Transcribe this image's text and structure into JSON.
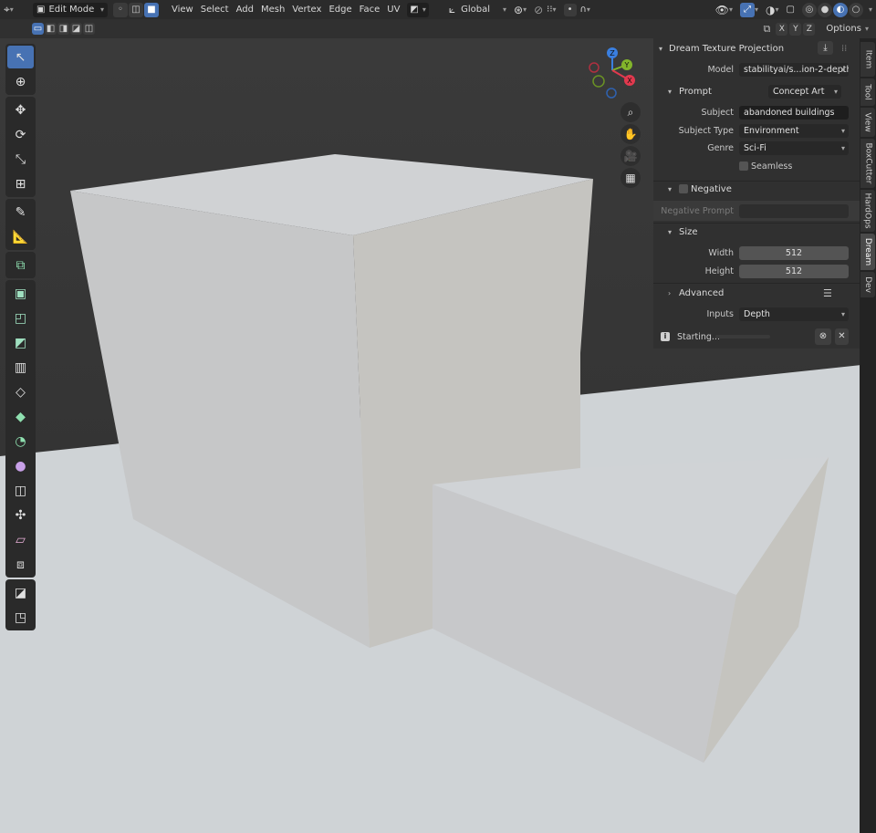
{
  "header": {
    "mode": "Edit Mode",
    "menus": [
      "View",
      "Select",
      "Add",
      "Mesh",
      "Vertex",
      "Edge",
      "Face",
      "UV"
    ],
    "transform_orientation": "Global"
  },
  "subheader": {
    "axes": [
      "X",
      "Y",
      "Z"
    ],
    "options_label": "Options"
  },
  "gizmo": {
    "x": "X",
    "y": "Y",
    "z": "Z"
  },
  "panel": {
    "title": "Dream Texture Projection",
    "model_label": "Model",
    "model_value": "stabilityai/s...ion-2-depth",
    "prompt_section": "Prompt",
    "prompt_preset": "Concept Art",
    "subject_label": "Subject",
    "subject_value": "abandoned buildings",
    "subject_type_label": "Subject Type",
    "subject_type_value": "Environment",
    "genre_label": "Genre",
    "genre_value": "Sci-Fi",
    "seamless_label": "Seamless",
    "negative_section": "Negative",
    "negative_prompt_label": "Negative Prompt",
    "size_section": "Size",
    "width_label": "Width",
    "width_value": "512",
    "height_label": "Height",
    "height_value": "512",
    "advanced_section": "Advanced",
    "inputs_label": "Inputs",
    "inputs_value": "Depth",
    "status_text": "Starting..."
  },
  "tabs": [
    "Item",
    "Tool",
    "View",
    "BoxCutter",
    "HardOps",
    "Dream",
    "Dev"
  ],
  "colors": {
    "accent": "#4772b3",
    "axis_x": "#e2394e",
    "axis_y": "#82b52b",
    "axis_z": "#3a7fe0"
  }
}
